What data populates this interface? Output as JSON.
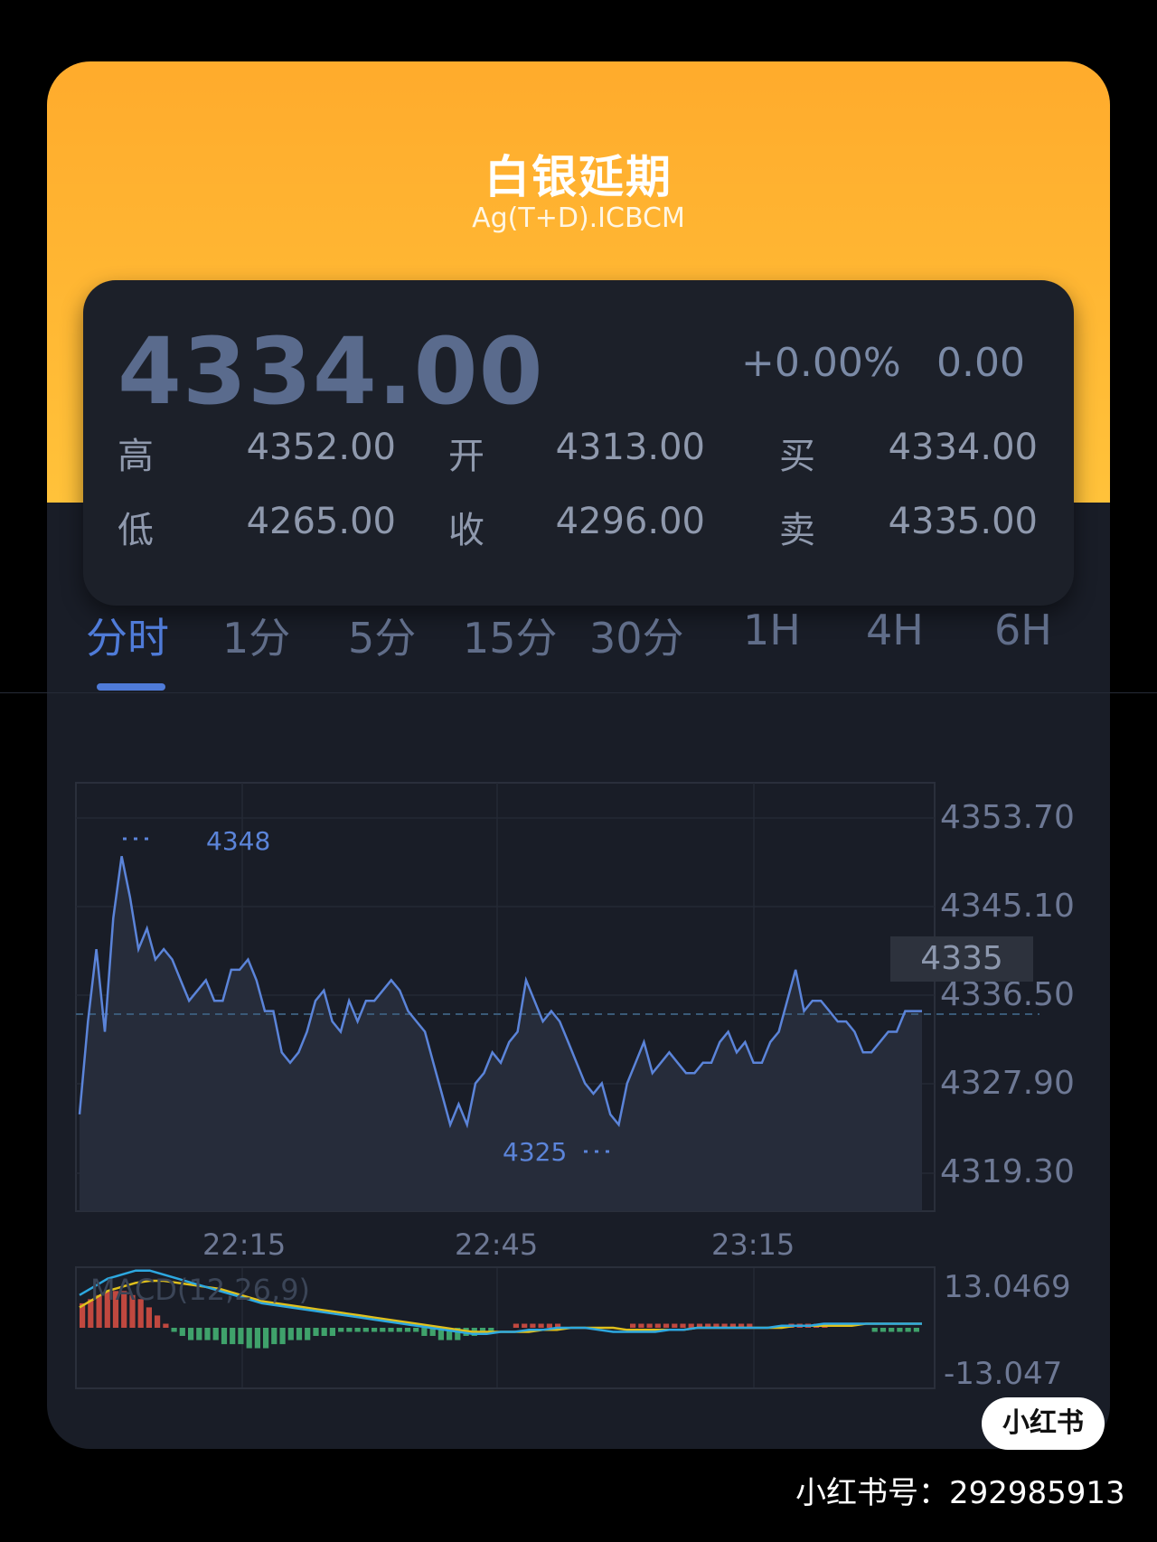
{
  "header": {
    "title": "白银延期",
    "subtitle": "Ag(T+D).ICBCM"
  },
  "quote": {
    "price": "4334.00",
    "change_pct": "+0.00%",
    "change": "0.00",
    "high_label": "高",
    "high": "4352.00",
    "low_label": "低",
    "low": "4265.00",
    "open_label": "开",
    "open": "4313.00",
    "close_label": "收",
    "close": "4296.00",
    "buy_label": "买",
    "buy": "4334.00",
    "sell_label": "卖",
    "sell": "4335.00"
  },
  "tabs": [
    {
      "label": "分时",
      "active": true
    },
    {
      "label": "1分",
      "active": false
    },
    {
      "label": "5分",
      "active": false
    },
    {
      "label": "15分",
      "active": false
    },
    {
      "label": "30分",
      "active": false
    },
    {
      "label": "1H",
      "active": false
    },
    {
      "label": "4H",
      "active": false
    },
    {
      "label": "6H",
      "active": false
    }
  ],
  "chart_labels": {
    "max_marker": "4348",
    "min_marker": "4325",
    "current": "4335",
    "y_ticks": [
      "4353.70",
      "4345.10",
      "4336.50",
      "4327.90",
      "4319.30"
    ],
    "x_ticks": [
      "22:15",
      "22:45",
      "23:15"
    ],
    "macd_label": "MACD(12,26,9)",
    "macd_ticks": [
      "13.0469",
      "-13.047"
    ]
  },
  "colors": {
    "accent": "#4f7bd8",
    "price_line": "#5b84d9",
    "macd_up": "#c0483f",
    "macd_down": "#3fa26b",
    "dif": "#2da8e0",
    "dea": "#e0c01c",
    "header": "#ffb22f"
  },
  "chart_data": {
    "type": "line",
    "title": "",
    "ylim": [
      4319.3,
      4353.7
    ],
    "y_ticks": [
      4353.7,
      4345.1,
      4336.5,
      4327.9,
      4319.3
    ],
    "x_ticks": [
      "22:15",
      "22:45",
      "23:15"
    ],
    "series": [
      {
        "values": [
          4325,
          4334,
          4341,
          4333,
          4344,
          4350,
          4346,
          4341,
          4343,
          4340,
          4341,
          4340,
          4338,
          4336,
          4337,
          4338,
          4336,
          4336,
          4339,
          4339,
          4340,
          4338,
          4335,
          4335,
          4331,
          4330,
          4331,
          4333,
          4336,
          4337,
          4334,
          4333,
          4336,
          4334,
          4336,
          4336,
          4337,
          4338,
          4337,
          4335,
          4334,
          4333,
          4330,
          4327,
          4324,
          4326,
          4324,
          4328,
          4329,
          4331,
          4330,
          4332,
          4333,
          4338,
          4336,
          4334,
          4335,
          4334,
          4332,
          4330,
          4328,
          4327,
          4328,
          4325,
          4324,
          4328,
          4330,
          4332,
          4329,
          4330,
          4331,
          4330,
          4329,
          4329,
          4330,
          4330,
          4332,
          4333,
          4331,
          4332,
          4330,
          4330,
          4332,
          4333,
          4336,
          4339,
          4335,
          4336,
          4336,
          4335,
          4334,
          4334,
          4333,
          4331,
          4331,
          4332,
          4333,
          4333,
          4335,
          4335,
          4335
        ]
      }
    ],
    "macd_ylim": [
      -13.047,
      13.0469
    ],
    "macd_hist": [
      6,
      7,
      8,
      9,
      9,
      9,
      8,
      7,
      5,
      3,
      1,
      -1,
      -2,
      -3,
      -3,
      -3,
      -3,
      -4,
      -4,
      -4,
      -5,
      -5,
      -5,
      -4,
      -4,
      -3,
      -3,
      -3,
      -2,
      -2,
      -2,
      -1,
      -1,
      -1,
      -1,
      -1,
      -1,
      -1,
      -1,
      -1,
      -1,
      -2,
      -2,
      -3,
      -3,
      -3,
      -2,
      -2,
      -1,
      -1,
      0,
      0,
      1,
      1,
      1,
      1,
      1,
      1,
      0,
      0,
      0,
      0,
      0,
      0,
      0,
      0,
      1,
      1,
      1,
      1,
      1,
      1,
      1,
      1,
      1,
      1,
      1,
      1,
      1,
      1,
      1,
      0,
      0,
      0,
      0,
      1,
      1,
      1,
      1,
      1,
      0,
      0,
      0,
      0,
      0,
      -1,
      -1,
      -1,
      -1,
      -1,
      -1
    ],
    "dif": [
      8,
      10,
      12,
      13,
      14,
      14,
      13,
      12,
      11,
      10,
      9,
      8,
      7,
      6,
      5.5,
      5,
      4.5,
      4,
      3.5,
      3,
      2.5,
      2,
      1.5,
      1,
      0.5,
      0,
      -0.5,
      -1,
      -1.5,
      -1.5,
      -1,
      -1,
      -0.5,
      -0.5,
      0,
      0,
      0,
      -0.5,
      -1,
      -1,
      -1,
      -1,
      -0.5,
      -0.5,
      0,
      0,
      0,
      0,
      0,
      0,
      0.5,
      0.5,
      0.5,
      1,
      1,
      1,
      1,
      1,
      1,
      1,
      1
    ],
    "dea": [
      5,
      7,
      9,
      10,
      11,
      11.5,
      11.5,
      11,
      10.5,
      10,
      9.5,
      8.5,
      7.5,
      6.5,
      6,
      5.5,
      5,
      4.5,
      4,
      3.5,
      3,
      2.5,
      2,
      1.5,
      1,
      0.5,
      0,
      -0.5,
      -1,
      -1,
      -1,
      -1,
      -1,
      -0.5,
      -0.5,
      0,
      0,
      0,
      0,
      -0.5,
      -0.5,
      -0.5,
      -0.5,
      -0.5,
      0,
      0,
      0,
      0,
      0,
      0,
      0,
      0.5,
      0.5,
      0.5,
      0.5,
      0.5,
      1,
      1,
      1,
      1,
      1
    ]
  },
  "watermark": {
    "badge": "小红书",
    "footer": "小红书号：292985913"
  }
}
